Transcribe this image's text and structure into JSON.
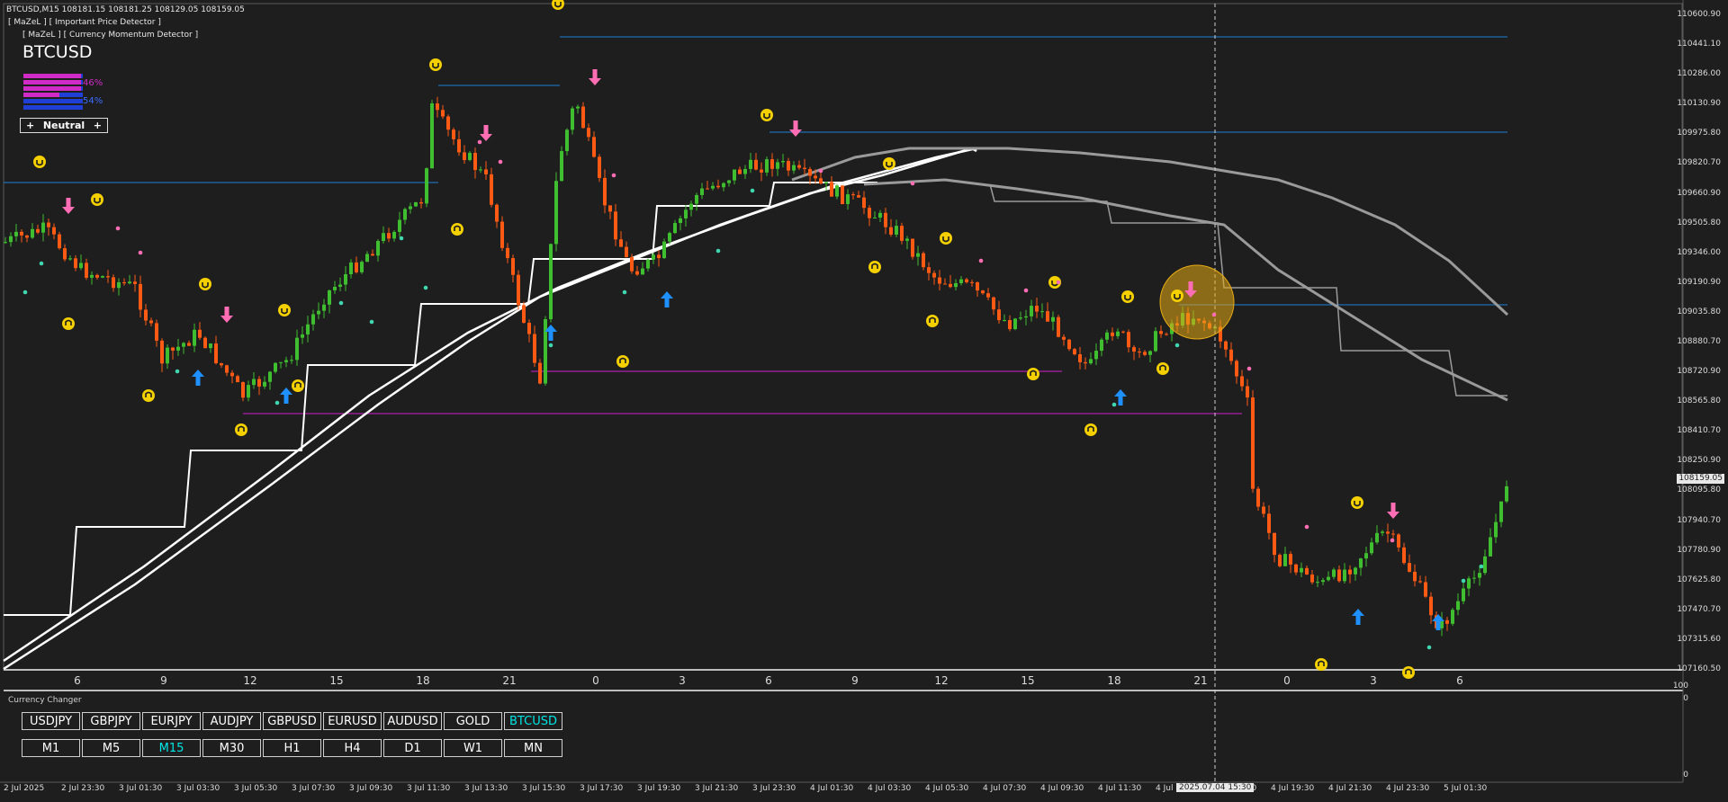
{
  "header": {
    "symbol_info": "BTCUSD,M15  108181.15 108181.25 108129.05 108159.05",
    "indicator1": "[ MaZeL ] [ Important Price Detector ]",
    "indicator2": "[ MaZeL ] [ Currency Momentum Detector ]",
    "symbol_title": "BTCUSD"
  },
  "momentum": {
    "sell_pct": "46%",
    "buy_pct": "54%",
    "sell_color": "#d02bc6",
    "buy_color": "#1f3fd6",
    "state_label": "Neutral",
    "plus_left": "+",
    "plus_right": "+"
  },
  "price_axis": {
    "labels": [
      "110600.90",
      "110441.10",
      "110286.00",
      "110130.90",
      "109975.80",
      "109820.70",
      "109660.90",
      "109505.80",
      "109346.00",
      "109190.90",
      "109035.80",
      "108880.70",
      "108720.90",
      "108565.80",
      "108410.70",
      "108250.90",
      "108095.80",
      "107940.70",
      "107780.90",
      "107625.80",
      "107470.70",
      "107315.60",
      "107160.50"
    ],
    "current_price": "108159.05"
  },
  "hour_axis": [
    "6",
    "9",
    "12",
    "15",
    "18",
    "21",
    "0",
    "3",
    "6",
    "9",
    "12",
    "15",
    "18",
    "21",
    "0",
    "3",
    "6"
  ],
  "sub_axis": [
    "100",
    "0",
    "0"
  ],
  "time_axis": [
    "2 Jul 2025",
    "2 Jul 23:30",
    "3 Jul 01:30",
    "3 Jul 03:30",
    "3 Jul 05:30",
    "3 Jul 07:30",
    "3 Jul 09:30",
    "3 Jul 11:30",
    "3 Jul 13:30",
    "3 Jul 15:30",
    "3 Jul 17:30",
    "3 Jul 19:30",
    "3 Jul 21:30",
    "3 Jul 23:30",
    "4 Jul 01:30",
    "4 Jul 03:30",
    "4 Jul 05:30",
    "4 Jul 07:30",
    "4 Jul 09:30",
    "4 Jul 11:30",
    "4 Jul",
    "4 Jul 17:30",
    "4 Jul 19:30",
    "4 Jul 21:30",
    "4 Jul 23:30",
    "5 Jul 01:30"
  ],
  "crosshair_time": "2025.07.04 15:30",
  "currency_changer": {
    "title": "Currency Changer",
    "symbols": [
      {
        "label": "USDJPY",
        "active": false
      },
      {
        "label": "GBPJPY",
        "active": false
      },
      {
        "label": "EURJPY",
        "active": false
      },
      {
        "label": "AUDJPY",
        "active": false
      },
      {
        "label": "GBPUSD",
        "active": false
      },
      {
        "label": "EURUSD",
        "active": false
      },
      {
        "label": "AUDUSD",
        "active": false
      },
      {
        "label": "GOLD",
        "active": false
      },
      {
        "label": "BTCUSD",
        "active": true
      }
    ],
    "timeframes": [
      {
        "label": "M1",
        "active": false
      },
      {
        "label": "M5",
        "active": false
      },
      {
        "label": "M15",
        "active": true
      },
      {
        "label": "M30",
        "active": false
      },
      {
        "label": "H1",
        "active": false
      },
      {
        "label": "H4",
        "active": false
      },
      {
        "label": "D1",
        "active": false
      },
      {
        "label": "W1",
        "active": false
      },
      {
        "label": "MN",
        "active": false
      }
    ]
  },
  "colors": {
    "background": "#1e1e1e",
    "bull_candle": "#3fbf2f",
    "bear_candle": "#ff5a14",
    "level_line_blue": "#1f7fd6",
    "level_line_magenta": "#d01fd0",
    "buy_arrow": "#1e90ff",
    "sell_arrow": "#ff6eb4",
    "signal_marker": "#f5d000",
    "active_button": "#00e5e5"
  },
  "icons": [
    "buy-arrow-icon",
    "sell-arrow-icon",
    "signal-up-icon",
    "signal-down-icon",
    "small-buy-icon",
    "small-sell-icon"
  ]
}
